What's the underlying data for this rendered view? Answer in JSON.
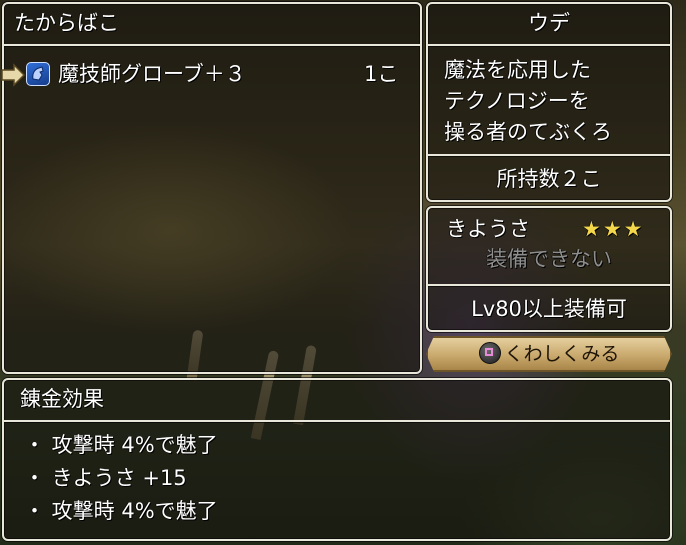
{
  "inventory": {
    "title": "たからばこ",
    "items": [
      {
        "icon": "gloves-icon",
        "name": "魔技師グローブ＋３",
        "count": "1こ"
      }
    ]
  },
  "item_detail": {
    "category": "ウデ",
    "description_lines": [
      "魔法を応用した",
      "テクノロジーを",
      "操る者のてぶくろ"
    ],
    "owned_count": "所持数２こ"
  },
  "equip_info": {
    "stat_name": "きようさ",
    "stars": "★★★",
    "equip_status": "装備できない",
    "level_requirement": "Lv80以上装備可"
  },
  "detail_button": {
    "icon": "square-button-icon",
    "label": "くわしくみる"
  },
  "alchemy": {
    "title": "錬金効果",
    "effects": [
      "・ 攻撃時 4%で魅了",
      "・ きようさ +15",
      "・ 攻撃時 4%で魅了"
    ]
  },
  "colors": {
    "panel_border": "#e9e6da",
    "star": "#f4d64a",
    "disabled_text": "#8e8e8e",
    "button_gold": "#c9a96d"
  }
}
